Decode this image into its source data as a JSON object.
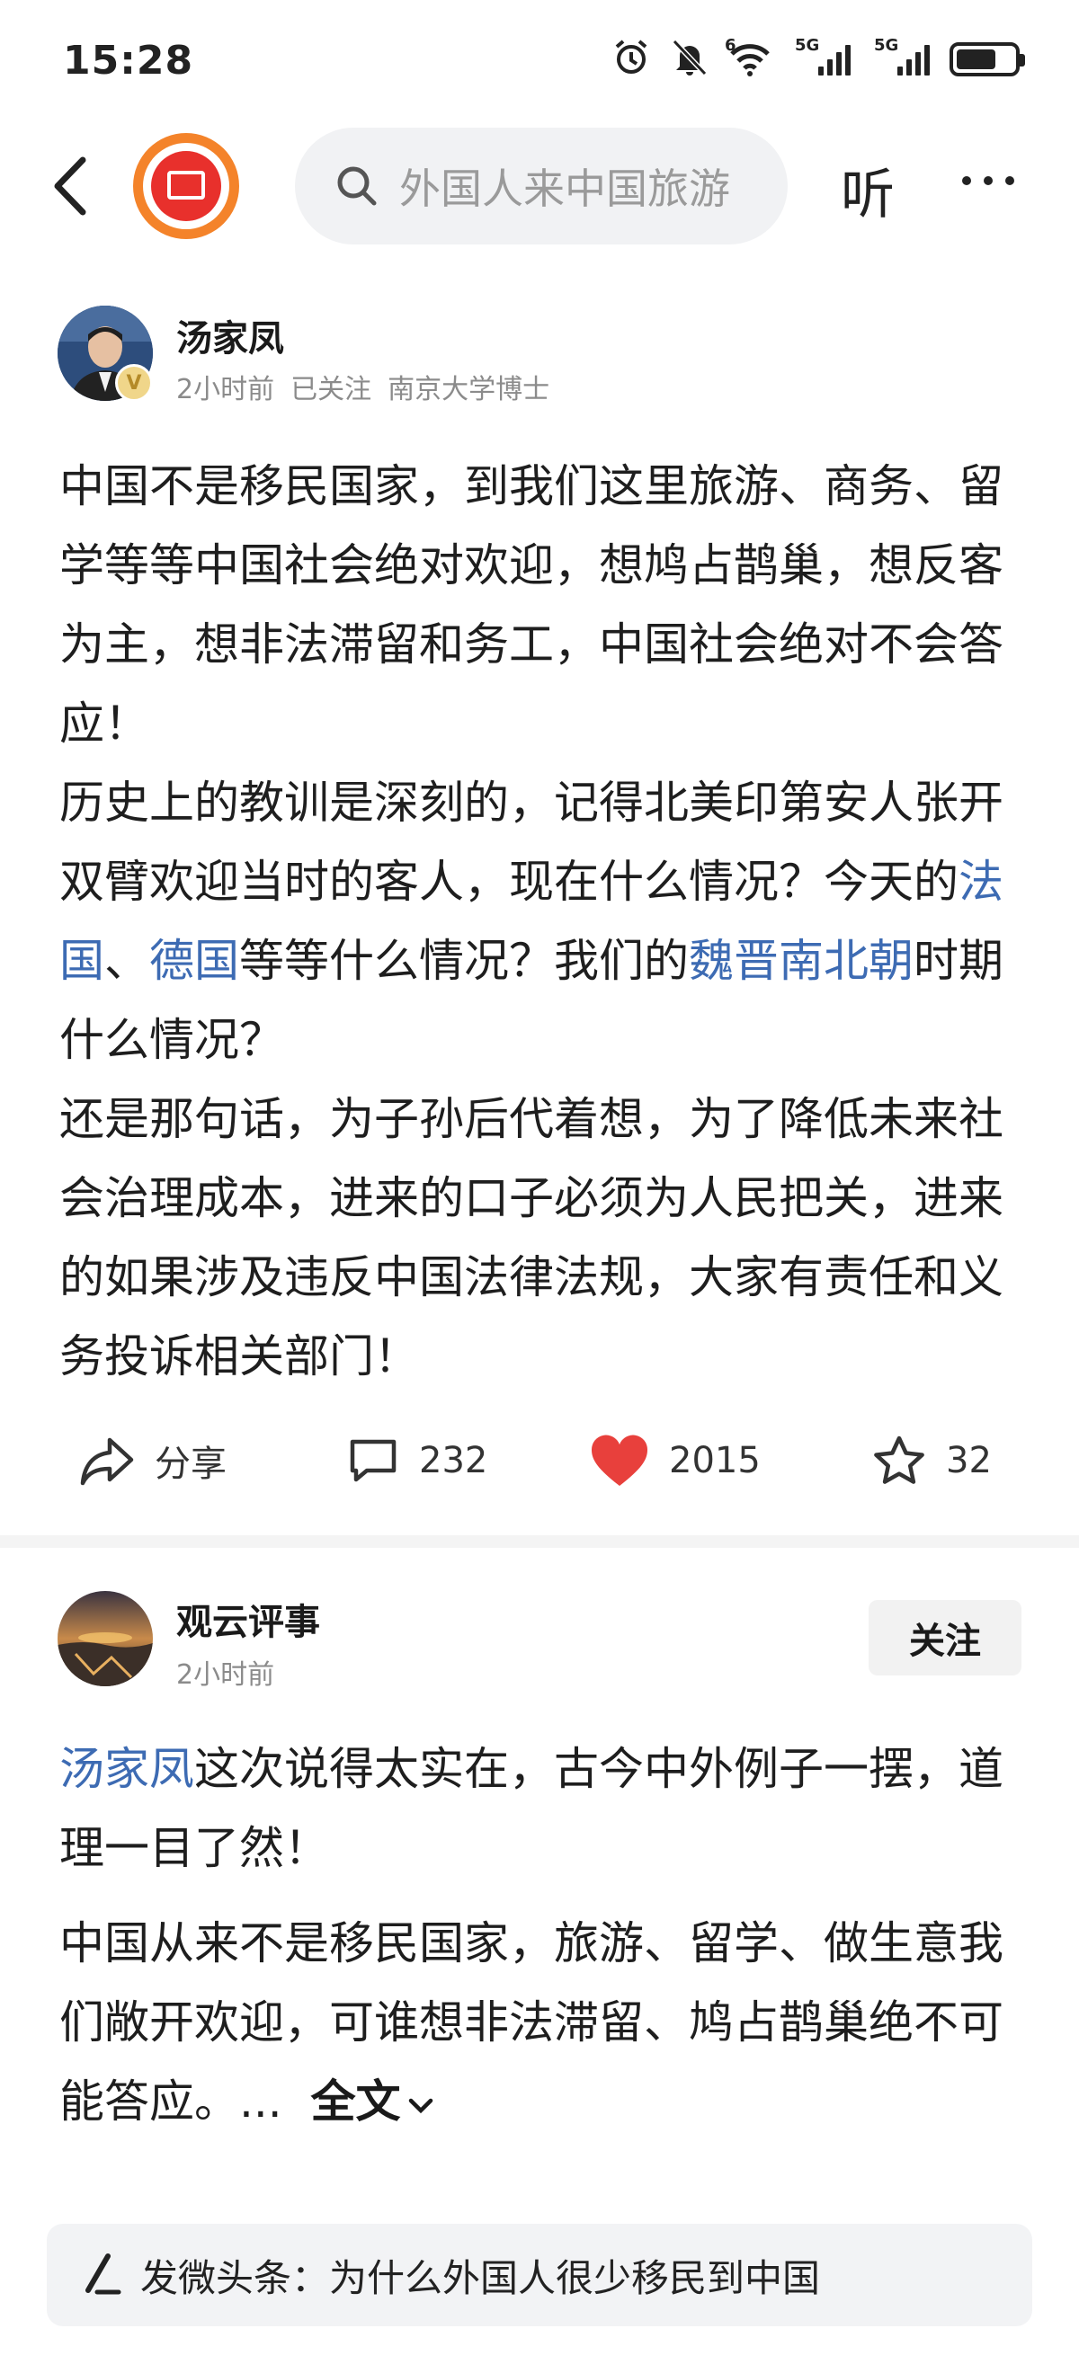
{
  "status_bar": {
    "time": "15:28",
    "signal1_label": "5G",
    "signal2_label": "5G",
    "wifi_label": "6",
    "icons": [
      "alarm-icon",
      "mute-icon",
      "wifi-icon",
      "signal-icon",
      "signal-icon",
      "battery-icon"
    ],
    "battery_level": 0.7
  },
  "nav": {
    "search_placeholder": "外国人来中国旅游",
    "listen_label": "听"
  },
  "post": {
    "author": "汤家凤",
    "time": "2小时前",
    "follow_status": "已关注",
    "credential": "南京大学博士",
    "verified_badge": "V",
    "p1": "中国不是移民国家，到我们这里旅游、商务、留学等等中国社会绝对欢迎，想鸠占鹊巢，想反客为主，想非法滞留和务工，中国社会绝对不会答应！",
    "p2": "历史上的教训是深刻的，记得北美印第安人张开双臂欢迎当时的客人，现在什么情况？今天的",
    "link_france": "法国",
    "sep": "、",
    "link_germany": "德国",
    "p2b": "等等什么情况？我们的",
    "link_weijin": "魏晋南北朝",
    "p2c": "时期什么情况？",
    "p3": "还是那句话，为子孙后代着想，为了降低未来社会治理成本，进来的口子必须为人民把关，进来的如果涉及违反中国法律法规，大家有责任和义务投诉相关部门！",
    "actions": {
      "share_label": "分享",
      "comments": "232",
      "likes": "2015",
      "favorites": "32"
    }
  },
  "comment": {
    "author": "观云评事",
    "time": "2小时前",
    "follow_label": "关注",
    "mention": "汤家凤",
    "p1": "这次说得太实在，古今中外例子一摆，道理一目了然！",
    "p2": "中国从来不是移民国家，旅游、留学、做生意我们敞开欢迎，可谁想非法滞留、鸠占鹊巢绝不可能答应。...",
    "full_text_label": "全文"
  },
  "compose": {
    "text": "发微头条：为什么外国人很少移民到中国"
  },
  "colors": {
    "link": "#3d6bb3",
    "like": "#e8403c",
    "logo_orange": "#f4832a",
    "logo_red": "#e8302c"
  }
}
